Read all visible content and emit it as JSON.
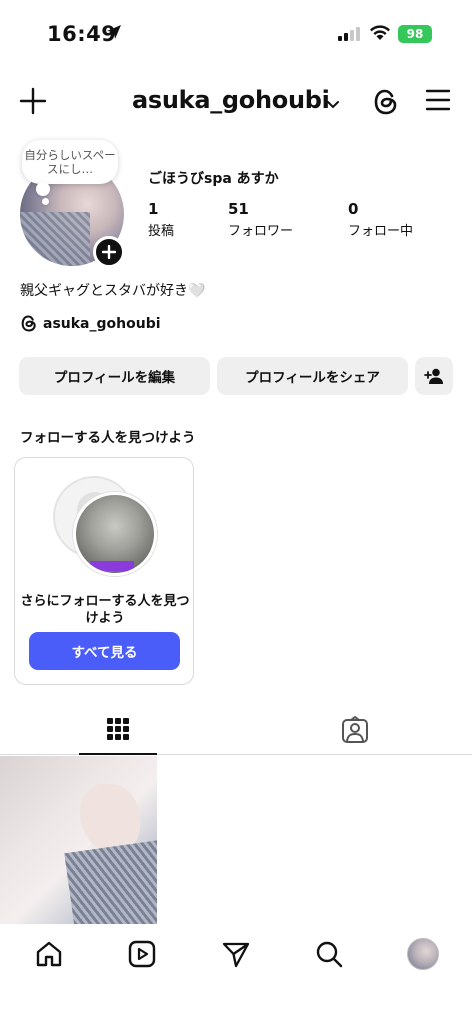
{
  "status_bar": {
    "time": "16:49",
    "battery": "98",
    "icons": [
      "location-arrow-icon",
      "signal-icon",
      "wifi-icon",
      "battery-icon"
    ]
  },
  "header": {
    "username": "asuka_gohoubi",
    "icons": [
      "plus-icon",
      "chevron-down-icon",
      "threads-icon",
      "menu-icon"
    ]
  },
  "profile": {
    "note": "自分らしいスペースにし…",
    "display_name": "ごほうびspa あすか",
    "stats": [
      {
        "value": "1",
        "label": "投稿"
      },
      {
        "value": "51",
        "label": "フォロワー"
      },
      {
        "value": "0",
        "label": "フォロー中"
      }
    ],
    "bio": "親父ギャグとスタバが好き🤍",
    "threads_handle": "asuka_gohoubi"
  },
  "actions": {
    "edit_profile": "プロフィールを編集",
    "share_profile": "プロフィールをシェア"
  },
  "suggestions": {
    "title": "フォローする人を見つけよう",
    "card_text": "さらにフォローする人を見つけよう",
    "see_all": "すべて見る"
  },
  "tabs": [
    "grid-icon",
    "tagged-icon"
  ],
  "bottom_nav": [
    "home-icon",
    "reels-icon",
    "send-icon",
    "search-icon",
    "profile-avatar"
  ],
  "colors": {
    "accent_button": "#4a5df9",
    "battery": "#34c759",
    "secondary_button": "#efefef"
  }
}
